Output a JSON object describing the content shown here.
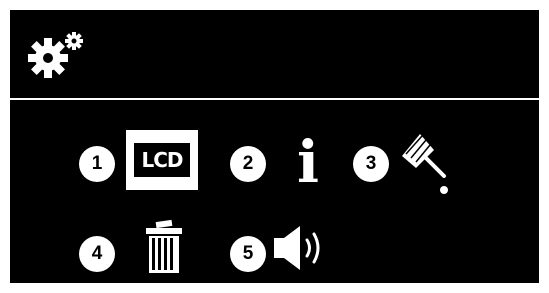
{
  "header": {
    "icon": "settings-gears-icon"
  },
  "menu": {
    "items": [
      {
        "number": "1",
        "icon": "lcd-display-icon",
        "icon_text": "LCD"
      },
      {
        "number": "2",
        "icon": "info-icon",
        "icon_text": "i"
      },
      {
        "number": "3",
        "icon": "cleaning-brush-icon"
      },
      {
        "number": "4",
        "icon": "trash-can-icon"
      },
      {
        "number": "5",
        "icon": "speaker-volume-icon"
      }
    ]
  },
  "colors": {
    "screen_background": "#000000",
    "foreground": "#ffffff"
  }
}
